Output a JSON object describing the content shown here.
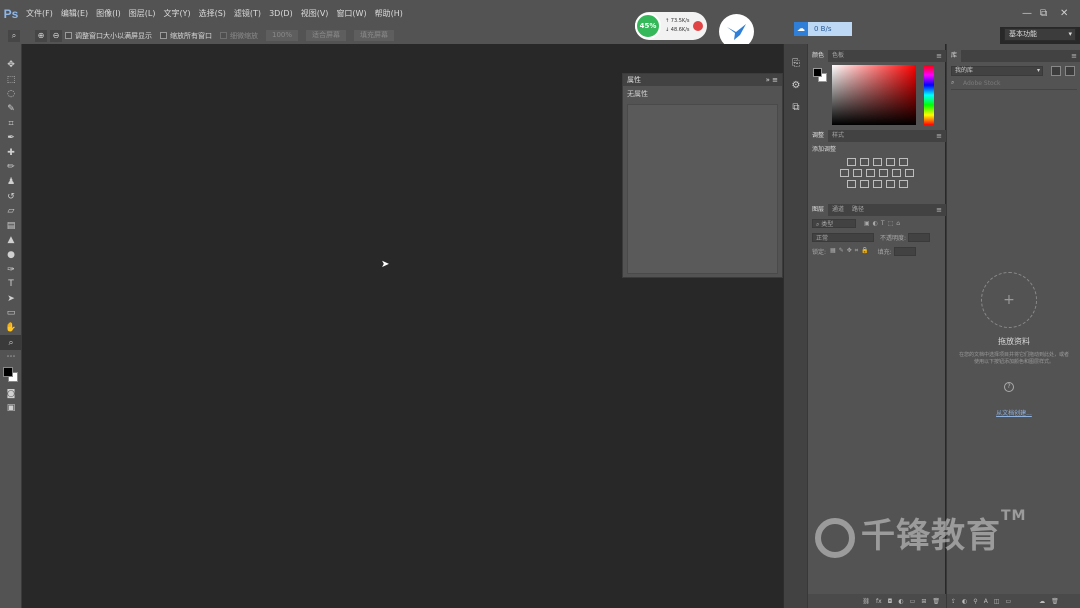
{
  "app": {
    "logo": "Ps"
  },
  "menu": [
    "文件(F)",
    "编辑(E)",
    "图像(I)",
    "图层(L)",
    "文字(Y)",
    "选择(S)",
    "滤镜(T)",
    "3D(D)",
    "视图(V)",
    "窗口(W)",
    "帮助(H)"
  ],
  "window_controls": {
    "minimize": "—",
    "restore": "⧉",
    "close": "✕"
  },
  "net_widget": {
    "percent": "45%",
    "up": "73.5K/s",
    "down": "48.6K/s"
  },
  "speed_widget": {
    "value": "0 B/s"
  },
  "workspace": {
    "selected": "基本功能"
  },
  "options_bar": {
    "resize_windows": "调整窗口大小以满屏显示",
    "zoom_all": "缩放所有窗口",
    "scrubby": "细微缩放",
    "percent": "100%",
    "fit_screen": "适合屏幕",
    "fill_screen": "填充屏幕"
  },
  "tools": [
    {
      "icon": "move-tool-icon",
      "glyph": "✥"
    },
    {
      "icon": "marquee-tool-icon",
      "glyph": "⬚"
    },
    {
      "icon": "lasso-tool-icon",
      "glyph": "◌"
    },
    {
      "icon": "quick-select-tool-icon",
      "glyph": "✎"
    },
    {
      "icon": "crop-tool-icon",
      "glyph": "⌗"
    },
    {
      "icon": "eyedropper-tool-icon",
      "glyph": "✒"
    },
    {
      "icon": "healing-brush-tool-icon",
      "glyph": "✚"
    },
    {
      "icon": "brush-tool-icon",
      "glyph": "✏"
    },
    {
      "icon": "stamp-tool-icon",
      "glyph": "♟"
    },
    {
      "icon": "history-brush-tool-icon",
      "glyph": "↺"
    },
    {
      "icon": "eraser-tool-icon",
      "glyph": "▱"
    },
    {
      "icon": "gradient-tool-icon",
      "glyph": "▤"
    },
    {
      "icon": "blur-tool-icon",
      "glyph": "▲"
    },
    {
      "icon": "dodge-tool-icon",
      "glyph": "●"
    },
    {
      "icon": "pen-tool-icon",
      "glyph": "✑"
    },
    {
      "icon": "type-tool-icon",
      "glyph": "T"
    },
    {
      "icon": "path-select-tool-icon",
      "glyph": "➤"
    },
    {
      "icon": "rectangle-tool-icon",
      "glyph": "▭"
    },
    {
      "icon": "hand-tool-icon",
      "glyph": "✋"
    },
    {
      "icon": "zoom-tool-icon",
      "glyph": "⌕"
    },
    {
      "icon": "more-tools-icon",
      "glyph": "⋯"
    }
  ],
  "properties": {
    "title": "属性",
    "subtitle": "无属性"
  },
  "color_panel": {
    "tabs": [
      "颜色",
      "色板"
    ]
  },
  "adjust_panel": {
    "tabs": [
      "调整",
      "样式"
    ],
    "title": "添加调整"
  },
  "layers_panel": {
    "tabs": [
      "图层",
      "通道",
      "路径"
    ],
    "filter": "类型",
    "blend": "正常",
    "opacity": "不透明度:",
    "lock": "锁定:",
    "fill": "填充:"
  },
  "library_panel": {
    "tab": "库",
    "selected": "我的库",
    "search": "Adobe Stock",
    "drop_title": "拖放资料",
    "drop_desc": "在您的文档中选择项目并将它们拖动到此处，或者使用以下按钮添加颜色和图层样式。",
    "link": "从文档创建..."
  },
  "watermark": {
    "text": "千锋教育",
    "tm": "TM"
  }
}
